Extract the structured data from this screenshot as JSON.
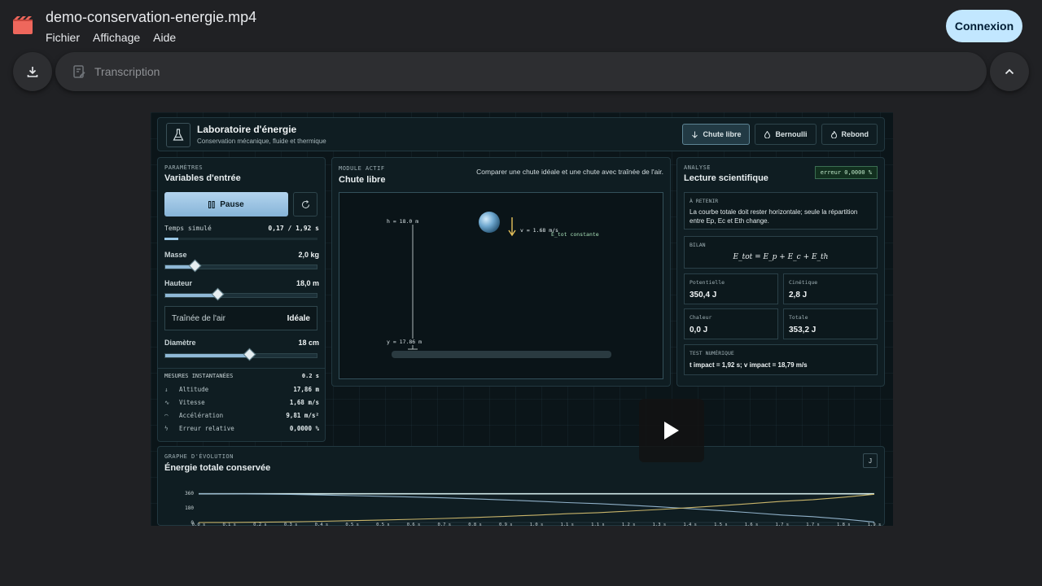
{
  "app": {
    "file_title": "demo-conservation-energie.mp4",
    "menu": [
      "Fichier",
      "Affichage",
      "Aide"
    ],
    "login_label": "Connexion",
    "transcript_label": "Transcription",
    "icons": {
      "file": "video-file-icon",
      "download": "download-icon",
      "transcript": "transcript-icon",
      "collapse": "chevron-up-icon",
      "play": "play-icon"
    },
    "colors": {
      "accent": "#c2e7ff",
      "file_icon": "#ee675c"
    }
  },
  "video": {
    "header": {
      "title": "Laboratoire d'énergie",
      "subtitle": "Conservation mécanique, fluide et thermique",
      "tabs": [
        {
          "label": "Chute libre",
          "active": true
        },
        {
          "label": "Bernoulli",
          "active": false
        },
        {
          "label": "Rebond",
          "active": false
        }
      ]
    },
    "params": {
      "eyebrow": "PARAMÈTRES",
      "title": "Variables d'entrée",
      "pause_label": "Pause",
      "time_label": "Temps simulé",
      "time_value": "0,17 / 1,92 s",
      "time_progress": 0.09,
      "mass_label": "Masse",
      "mass_value": "2,0 kg",
      "mass_level": 0.2,
      "height_label": "Hauteur",
      "height_value": "18,0 m",
      "height_level": 0.35,
      "drag_label": "Traînée de l'air",
      "drag_value": "Idéale",
      "diameter_label": "Diamètre",
      "diameter_value": "18 cm",
      "diameter_level": 0.56,
      "measures_title": "MESURES INSTANTANÉES",
      "measures_time": "0.2 s",
      "measures": [
        {
          "label": "Altitude",
          "value": "17,86 m",
          "icon": "arrow-down-icon"
        },
        {
          "label": "Vitesse",
          "value": "1,68 m/s",
          "icon": "pulse-icon"
        },
        {
          "label": "Accélération",
          "value": "9,81 m/s²",
          "icon": "gauge-icon"
        },
        {
          "label": "Erreur relative",
          "value": "0,0000 %",
          "icon": "bolt-icon"
        }
      ]
    },
    "module": {
      "eyebrow": "MODULE ACTIF",
      "title": "Chute libre",
      "compare_text": "Comparer une chute idéale et une chute avec traînée de l'air.",
      "h_label": "h = 18.0 m",
      "y_label": "y = 17.86 m",
      "v_label": "v = 1.68 m/s",
      "etot_label": "E_tot constante"
    },
    "analysis": {
      "eyebrow": "ANALYSE",
      "title": "Lecture scientifique",
      "error_badge": "erreur 0,0000 %",
      "retain_label": "À RETENIR",
      "retain_text": "La courbe totale doit rester horizontale; seule la répartition entre Ep, Ec et Eth change.",
      "bilan_label": "BILAN",
      "formula": "E_tot = E_p + E_c + E_th",
      "cards": [
        {
          "label": "Potentielle",
          "value": "350,4 J"
        },
        {
          "label": "Cinétique",
          "value": "2,8 J"
        },
        {
          "label": "Chaleur",
          "value": "0,0 J"
        },
        {
          "label": "Totale",
          "value": "353,2 J"
        }
      ],
      "test_label": "TEST NUMÉRIQUE",
      "test_value": "t impact = 1,92 s; v impact = 18,79 m/s"
    },
    "graph": {
      "eyebrow": "GRAPHE D'ÉVOLUTION",
      "title": "Énergie totale conservée",
      "button_label": "J"
    }
  },
  "chart_data": {
    "type": "line",
    "title": "Énergie totale conservée",
    "ylim": [
      0,
      360
    ],
    "yticks": [
      "360",
      "180",
      "0"
    ],
    "categories": [
      "0.0 s",
      "0.1 s",
      "0.2 s",
      "0.3 s",
      "0.4 s",
      "0.5 s",
      "0.5 s",
      "0.6 s",
      "0.7 s",
      "0.8 s",
      "0.9 s",
      "1.0 s",
      "1.1 s",
      "1.1 s",
      "1.2 s",
      "1.3 s",
      "1.4 s",
      "1.5 s",
      "1.6 s",
      "1.7 s",
      "1.7 s",
      "1.8 s",
      "1.9 s"
    ],
    "series": [
      {
        "color": "#cfe8e8",
        "values": [
          353,
          353,
          353,
          353,
          353,
          353,
          353,
          353,
          353,
          353,
          353,
          353,
          353,
          353,
          353,
          353,
          353,
          353,
          353,
          353,
          353,
          353,
          353
        ]
      },
      {
        "color": "#8fb0c8",
        "values": [
          353,
          352,
          349,
          345,
          338,
          330,
          322,
          313,
          303,
          291,
          277,
          262,
          245,
          232,
          213,
          193,
          170,
          146,
          120,
          92,
          72,
          42,
          6
        ]
      },
      {
        "color": "#c8b46a",
        "values": [
          0,
          1,
          4,
          8,
          15,
          23,
          31,
          40,
          50,
          62,
          76,
          91,
          108,
          121,
          140,
          160,
          183,
          207,
          233,
          261,
          281,
          311,
          347
        ]
      }
    ],
    "grid": false
  }
}
